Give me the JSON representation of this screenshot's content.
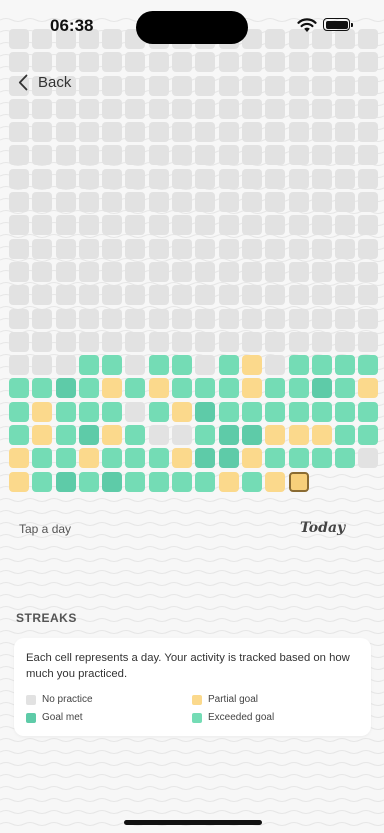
{
  "status_bar": {
    "time": "06:38",
    "wifi_icon": "wifi-icon",
    "battery_icon": "battery-icon"
  },
  "nav": {
    "back_label": "Back",
    "back_icon": "chevron-left-icon"
  },
  "grid": {
    "columns": 16,
    "states": [
      "empty",
      "partial",
      "met",
      "exceeded",
      "today"
    ],
    "rows": [
      "EEEEEEEEEEEEEEEE",
      "EEEEEEEEEEEEEEEE",
      "EEEEEEEEEEEEEEEE",
      "EEEEEEEEEEEEEEEE",
      "EEEEEEEEEEEEEEEE",
      "EEEEEEEEEEEEEEEE",
      "EEEEEEEEEEEEEEEE",
      "EEEEEEEEEEEEEEEE",
      "EEEEEEEEEEEEEEEE",
      "EEEEEEEEEEEEEEEE",
      "EEEEEEEEEEEEEEEE",
      "EEEEEEEEEEEEEEEE",
      "EEEEEEEEEEEEEEEE",
      "EEEEEEEEEEEEEEEE",
      "EEEXXEXXEXPEXXXX",
      "XXMXPXPXXXPXXMXP",
      "XPXXXEXPMXXXXXXX",
      "XPXMPXEEXMMPPPXX",
      "PXXPXXXPMMPXXXXE",
      "PXMXMXXXXPXPT---"
    ]
  },
  "labels": {
    "hint": "Tap a day",
    "today": "Today"
  },
  "streaks": {
    "title": "STREAKS",
    "description": "Each cell represents a day. Your activity is tracked based on how much you practiced.",
    "legend": [
      {
        "label": "No practice",
        "color": "#e2e2e2"
      },
      {
        "label": "Partial goal",
        "color": "#fbd98c"
      },
      {
        "label": "Goal met",
        "color": "#5ecba8"
      },
      {
        "label": "Exceeded goal",
        "color": "#74dcb5"
      }
    ]
  }
}
